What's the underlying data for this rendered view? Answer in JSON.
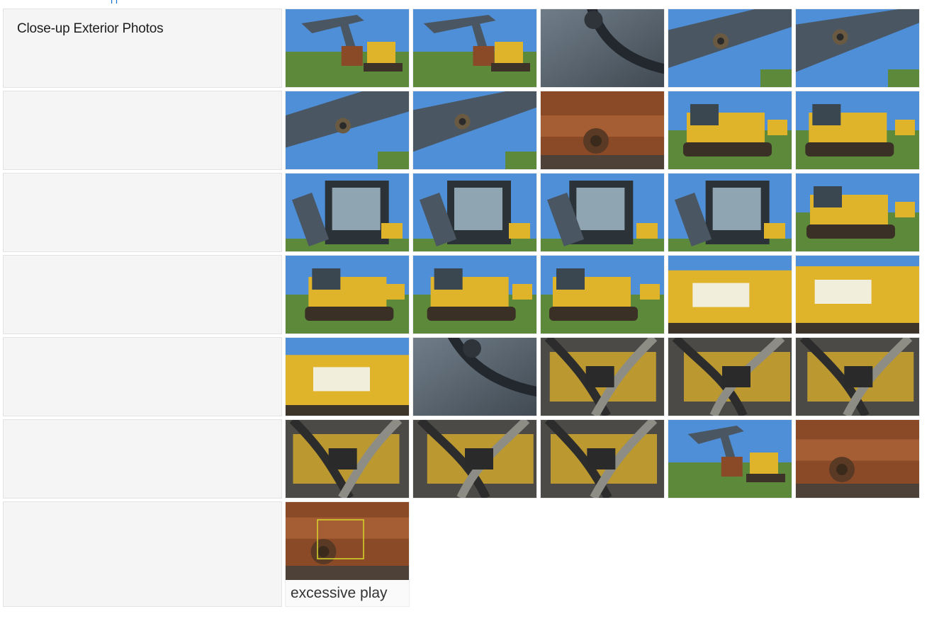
{
  "section": {
    "title": "Close-up Exterior Photos"
  },
  "rows": [
    {
      "photos": [
        {
          "name": "photo-excavator-left-side",
          "scene": "excavator-boom"
        },
        {
          "name": "photo-excavator-boom-deere",
          "scene": "excavator-boom"
        },
        {
          "name": "photo-boom-hose-closeup",
          "scene": "closeup-steel"
        },
        {
          "name": "photo-boom-pin-closeup",
          "scene": "boom-sky"
        },
        {
          "name": "photo-boom-deere-lettering",
          "scene": "boom-sky"
        }
      ]
    },
    {
      "photos": [
        {
          "name": "photo-boom-work-light",
          "scene": "boom-sky"
        },
        {
          "name": "photo-cylinder-rod-end",
          "scene": "boom-sky"
        },
        {
          "name": "photo-bucket-linkage-rust",
          "scene": "rusty-closeup"
        },
        {
          "name": "photo-bucket-and-cab-front",
          "scene": "yellow-machine"
        },
        {
          "name": "photo-undercarriage-track",
          "scene": "yellow-machine"
        }
      ]
    },
    {
      "photos": [
        {
          "name": "photo-cab-left-front",
          "scene": "cab-sky"
        },
        {
          "name": "photo-cab-front-door",
          "scene": "cab-sky"
        },
        {
          "name": "photo-cab-mirror",
          "scene": "cab-sky"
        },
        {
          "name": "photo-cab-side-window",
          "scene": "cab-sky"
        },
        {
          "name": "photo-cab-and-trucks",
          "scene": "yellow-machine"
        }
      ]
    },
    {
      "photos": [
        {
          "name": "photo-rear-left-counterweight",
          "scene": "yellow-machine"
        },
        {
          "name": "photo-rear-doggett-counterweight",
          "scene": "yellow-machine"
        },
        {
          "name": "photo-rear-right-quarter",
          "scene": "yellow-machine"
        },
        {
          "name": "photo-counterweight-doggett-closeup",
          "scene": "yellow-closeup"
        },
        {
          "name": "photo-deere-decal-closeup",
          "scene": "yellow-closeup"
        }
      ]
    },
    {
      "photos": [
        {
          "name": "photo-engine-side-470g",
          "scene": "yellow-closeup"
        },
        {
          "name": "photo-top-deck-handle",
          "scene": "closeup-steel"
        },
        {
          "name": "photo-swing-area-hoses",
          "scene": "hydraulics"
        },
        {
          "name": "photo-swing-bearing-hoses",
          "scene": "hydraulics"
        },
        {
          "name": "photo-swivel-hoses-underside",
          "scene": "hydraulics"
        }
      ]
    },
    {
      "photos": [
        {
          "name": "photo-center-joint-hoses-1",
          "scene": "hydraulics"
        },
        {
          "name": "photo-center-joint-hoses-2",
          "scene": "hydraulics"
        },
        {
          "name": "photo-center-joint-hoses-3",
          "scene": "hydraulics"
        },
        {
          "name": "photo-excavator-boom-bucket-field",
          "scene": "excavator-boom"
        },
        {
          "name": "photo-bucket-teeth-closeup",
          "scene": "rusty-closeup"
        }
      ]
    },
    {
      "photos": [
        {
          "name": "photo-bucket-pin-excessive-play",
          "scene": "rusty-closeup",
          "caption": "excessive play"
        }
      ]
    }
  ],
  "colors": {
    "sky": "#4f8fd8",
    "grass": "#5d8a3a",
    "deere_yellow": "#e0b42a",
    "steel": "#4a5763",
    "rust": "#8a4a28",
    "annotation_box": "#d7d72a"
  }
}
